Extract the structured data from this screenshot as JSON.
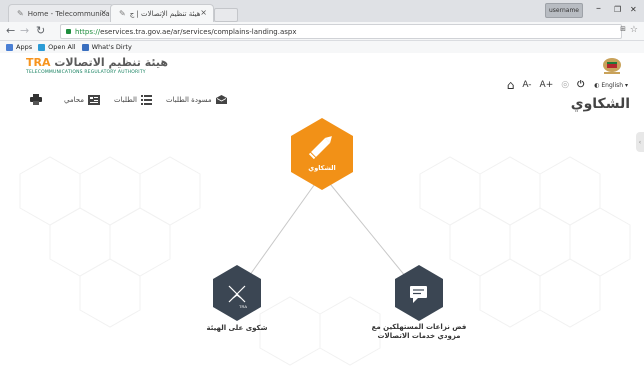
{
  "browser": {
    "tabs": [
      {
        "title": "Home - Telecommunica"
      },
      {
        "title": "هيئة تنظيم الإتصالات | ج"
      }
    ],
    "user_label": "username",
    "window_controls": {
      "minimize": "–",
      "restore": "❐",
      "close": "✕"
    },
    "url_scheme": "https://",
    "url_rest": "eservices.tra.gov.ae/ar/services/complains-landing.aspx",
    "bookmarks": [
      {
        "label": "Apps",
        "color": "#4a7fd4"
      },
      {
        "label": "Open All",
        "color": "#2a9bd6"
      },
      {
        "label": "What's Dirty",
        "color": "#3a6fbf"
      }
    ]
  },
  "header": {
    "logo_ar": "هيئة تنظيم الاتصالات",
    "logo_tra": "TRA",
    "logo_sub": "TELECOMMUNICATIONS REGULATORY AUTHORITY",
    "tools": {
      "home": "⌂",
      "font_smaller": "A-",
      "font_larger": "A+",
      "contrast": "◎",
      "power": "⏻",
      "language": "English"
    },
    "page_title": "الشكاوي"
  },
  "toolbar": {
    "draft_requests": "مسودة الطلبات",
    "requests": "الطلبات",
    "my_lawyer": "محامي"
  },
  "hub": {
    "label": "الشكاوي",
    "color": "#f29117"
  },
  "nodes": {
    "complaint_tra": "شكوى على الهيئة",
    "consumer_disputes_line1": "فض نزاعات المستهلكين مع",
    "consumer_disputes_line2": "مزودي خدمات الاتصالات",
    "color": "#3b4653"
  },
  "colors": {
    "accent": "#f29117",
    "dark_hex": "#3b4653",
    "https_green": "#1e8e3e"
  }
}
